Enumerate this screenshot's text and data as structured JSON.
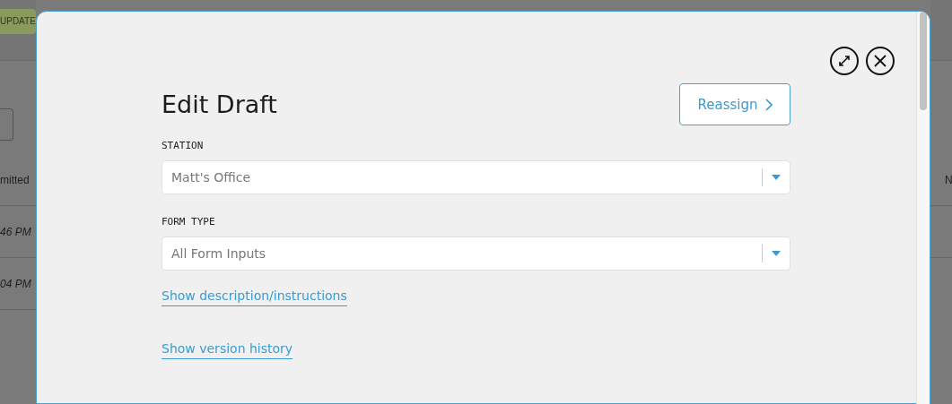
{
  "background": {
    "tag": "UPDATE",
    "left_header": "mitted",
    "left_rows": [
      "46 PM",
      "04 PM"
    ],
    "right_header": "N"
  },
  "dialog": {
    "title": "Edit Draft",
    "reassign_button": "Reassign",
    "fields": [
      {
        "label": "STATION",
        "value": "Matt's Office"
      },
      {
        "label": "FORM TYPE",
        "value": "All Form Inputs"
      }
    ],
    "links": [
      "Show description/instructions",
      "Show version history"
    ]
  }
}
